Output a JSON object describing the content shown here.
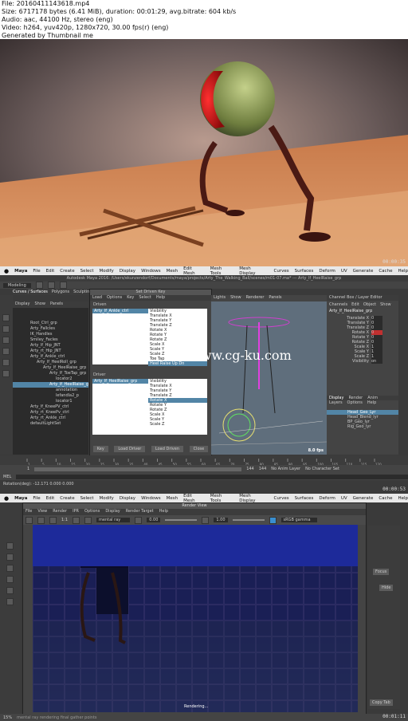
{
  "file_info": [
    "File: 20160411143618.mp4",
    "Size: 6717178 bytes (6.41 MiB), duration: 00:01:29, avg.bitrate: 604 kb/s",
    "Audio: aac, 44100 Hz, stereo (eng)",
    "Video: h264, yuv420p, 1280x720, 30.00 fps(r) (eng)",
    "Generated by Thumbnail me"
  ],
  "timestamps": [
    "00:00:35",
    "00:00:53",
    "00:01:11"
  ],
  "watermark": "www.cg-ku.com",
  "mac_menu": [
    "Maya",
    "File",
    "Edit",
    "Create",
    "Select",
    "Modify",
    "Display",
    "Windows",
    "Mesh",
    "Edit Mesh",
    "Mesh Tools",
    "Mesh Display",
    "Curves",
    "Surfaces",
    "Deform",
    "UV",
    "Generate",
    "Cache",
    "Help"
  ],
  "maya_title": "Autodesk Maya 2016: /Users/ekunzendorf/Documents/maya/projects/Arty_The_Walking_Ball/scenes/m01-07.ma* --- Arty_lf_HeelRaise_grp",
  "maya_menus": [
    "File",
    "Edit",
    "Create",
    "Select",
    "Modify",
    "Display",
    "Windows",
    "Mesh",
    "Edit Mesh",
    "Mesh Tools",
    "Mesh Display",
    "Curves",
    "Surfaces",
    "Deform",
    "UV",
    "Generate",
    "Cache",
    "Help"
  ],
  "mode": "Modeling",
  "shelf_tabs": [
    "Curves / Surfaces",
    "Polygons",
    "Sculpting"
  ],
  "outliner": {
    "menus": [
      "Display",
      "Show",
      "Panels"
    ],
    "items": [
      "Root_Ctrl_grp",
      "Arty_Fallcles",
      "IK_Handles",
      "Smiley_Facles",
      "Arty_lf_Hip_JNT",
      "Arty_rt_Hip_JNT",
      "Arty_lf_Ankle_ctrl",
      "Arty_lf_HeelRoll_grp",
      "Arty_lf_HeelRaise_grp",
      "Arty_lf_ToeTap_grp",
      "locator2",
      "Arty_lf_HeelRaise_grp",
      "annotation",
      "lefandla2_p",
      "locator1",
      "Arty_lf_KneePV_ctrl",
      "Arty_rt_KneePv_ctrl",
      "Arty_rt_Ankle_ctrl",
      "defaultLightSet"
    ]
  },
  "sdk": {
    "title": "Set Driven Key",
    "menus": [
      "Load",
      "Options",
      "Key",
      "Select",
      "Help"
    ],
    "driven_label": "Driven",
    "driver_label": "Driver",
    "driven_object": "Arty_lf_Ankle_ctrl",
    "driven_attrs": [
      "Visibility",
      "Translate X",
      "Translate Y",
      "Translate Z",
      "Rotate X",
      "Rotate Y",
      "Rotate Z",
      "Scale X",
      "Scale Y",
      "Scale Z",
      "Toe Tap",
      "Heel Raise Up Dn"
    ],
    "driver_object": "Arty_lf_HeelRaise_grp",
    "driver_attrs": [
      "Visibility",
      "Translate X",
      "Translate Y",
      "Translate Z",
      "Rotate X",
      "Rotate Y",
      "Rotate Z",
      "Scale X",
      "Scale Y",
      "Scale Z"
    ],
    "buttons": [
      "Key",
      "Load Driver",
      "Load Driven",
      "Close"
    ]
  },
  "viewport": {
    "fps": "8.0 fps",
    "menus": [
      "Lights",
      "Show",
      "Renderer",
      "Panels"
    ]
  },
  "channel_box": {
    "title": "Channel Box / Layer Editor",
    "menus": [
      "Channels",
      "Edit",
      "Object",
      "Show"
    ],
    "object": "Arty_lf_HeelRaise_grp",
    "attrs": [
      {
        "name": "Translate X",
        "value": "0"
      },
      {
        "name": "Translate Y",
        "value": "0"
      },
      {
        "name": "Translate Z",
        "value": "0"
      },
      {
        "name": "Rotate X",
        "value": "0"
      },
      {
        "name": "Rotate Y",
        "value": "0"
      },
      {
        "name": "Rotate Z",
        "value": "0"
      },
      {
        "name": "Scale X",
        "value": "1"
      },
      {
        "name": "Scale Y",
        "value": "1"
      },
      {
        "name": "Scale Z",
        "value": "1"
      },
      {
        "name": "Visibility",
        "value": "on"
      }
    ],
    "layer_tabs": [
      "Display",
      "Render",
      "Anim"
    ],
    "layer_menus": [
      "Layers",
      "Options",
      "Help"
    ],
    "layers": [
      "Head_Geo_Lyr",
      "Head_Blend_lyr",
      "BP_Geo_lyr",
      "Rig_Geo_lyr"
    ]
  },
  "timeline": {
    "ticks": [
      "1",
      "5",
      "10",
      "15",
      "20",
      "25",
      "30",
      "35",
      "40",
      "45",
      "50",
      "55",
      "60",
      "65",
      "70",
      "75",
      "80",
      "85",
      "90",
      "95",
      "100",
      "105",
      "110",
      "115",
      "120"
    ],
    "start": "1",
    "end": "144",
    "range_end": "144",
    "anim_layer": "No Anim Layer",
    "character_set": "No Character Set",
    "mel": "MEL",
    "status": "Rotation(deg): -12.171  0.000  0.000"
  },
  "render_view": {
    "title": "Render View",
    "menus": [
      "File",
      "View",
      "Render",
      "IPR",
      "Options",
      "Display",
      "Render Target",
      "Help"
    ],
    "renderer": "mental ray",
    "exposure": "0.00",
    "gamma": "1.00",
    "color_mgmt": "sRGB gamma",
    "progress_label": "Rendering...",
    "zoom": "1:1",
    "status_text": "mental ray rendering final gather points",
    "percent": "15%",
    "right_buttons": [
      "Focus",
      "Hide",
      "Copy Tab"
    ]
  }
}
